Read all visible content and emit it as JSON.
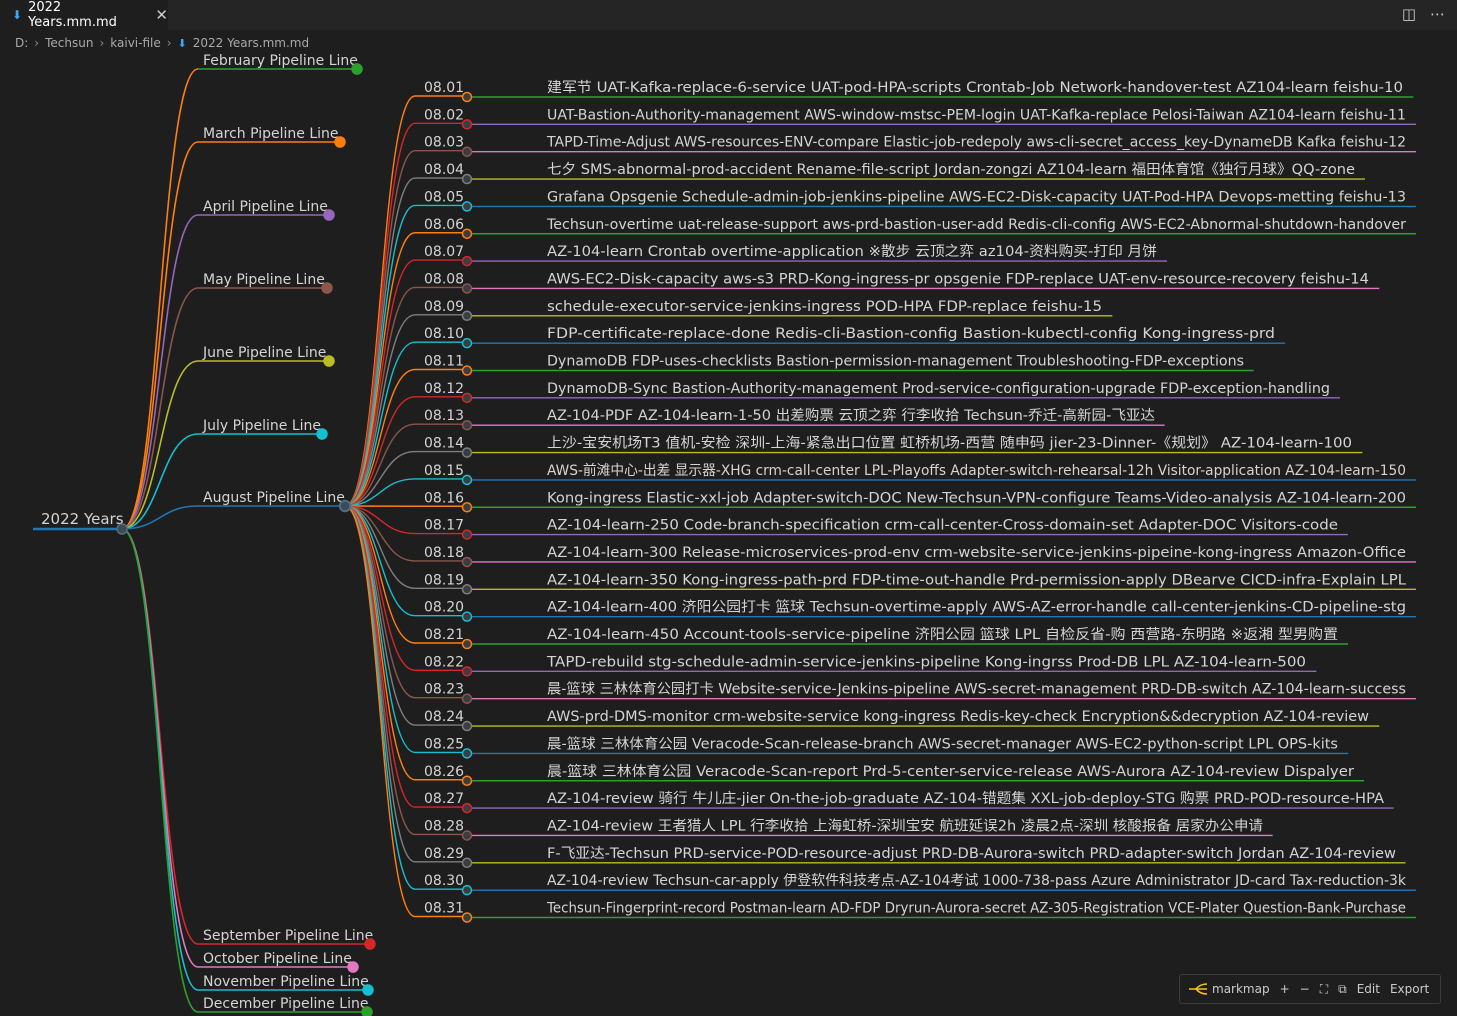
{
  "tab": {
    "title": "2022 Years.mm.md",
    "icon": "markdown-download-icon"
  },
  "breadcrumb": [
    "D:",
    "Techsun",
    "kaivi-file",
    "2022 Years.mm.md"
  ],
  "toolbar": {
    "brand": "markmap",
    "zoom_in": "+",
    "zoom_out": "−",
    "fit": "⛶",
    "toggle": "⧉",
    "edit": "Edit",
    "export": "Export"
  },
  "colors": {
    "root": "#1f77b4",
    "branch": [
      "#ff7f0e",
      "#ff7f0e",
      "#9467bd",
      "#8c564b",
      "#bcbd22",
      "#17becf",
      "#1f77b4",
      "#d62728",
      "#e377c2",
      "#17becf",
      "#2ca02c"
    ],
    "day": [
      "#ff7f0e",
      "#d62728",
      "#8c564b",
      "#7f7f7f",
      "#17becf",
      "#ff7f0e",
      "#d62728",
      "#8c564b",
      "#7f7f7f",
      "#17becf",
      "#ff7f0e",
      "#d62728",
      "#8c564b",
      "#7f7f7f",
      "#17becf",
      "#ff7f0e",
      "#d62728",
      "#8c564b",
      "#7f7f7f",
      "#17becf",
      "#ff7f0e",
      "#d62728",
      "#8c564b",
      "#7f7f7f",
      "#17becf",
      "#ff7f0e",
      "#d62728",
      "#8c564b",
      "#7f7f7f",
      "#17becf",
      "#ff7f0e"
    ],
    "line": [
      "#2ca02c",
      "#9467bd",
      "#e377c2",
      "#bcbd22",
      "#1f77b4",
      "#2ca02c",
      "#9467bd",
      "#e377c2",
      "#bcbd22",
      "#1f77b4",
      "#2ca02c",
      "#9467bd",
      "#e377c2",
      "#bcbd22",
      "#1f77b4",
      "#2ca02c",
      "#9467bd",
      "#e377c2",
      "#bcbd22",
      "#1f77b4",
      "#2ca02c",
      "#9467bd",
      "#e377c2",
      "#bcbd22",
      "#1f77b4",
      "#2ca02c",
      "#9467bd",
      "#e377c2",
      "#bcbd22",
      "#1f77b4",
      "#2ca02c"
    ]
  },
  "mindmap": {
    "root": "2022 Years",
    "months_top": [
      {
        "label": "February Pipeline Line",
        "color": "#2ca02c"
      },
      {
        "label": "March Pipeline Line",
        "color": "#ff7f0e"
      },
      {
        "label": "April Pipeline Line",
        "color": "#9467bd"
      },
      {
        "label": "May Pipeline Line",
        "color": "#8c564b"
      },
      {
        "label": "June Pipeline Line",
        "color": "#bcbd22"
      },
      {
        "label": "July Pipeline Line",
        "color": "#17becf"
      },
      {
        "label": "August Pipeline Line",
        "color": "#1f77b4"
      }
    ],
    "months_bottom": [
      {
        "label": "September Pipeline Line",
        "color": "#d62728"
      },
      {
        "label": "October Pipeline Line",
        "color": "#e377c2"
      },
      {
        "label": "November Pipeline Line",
        "color": "#17becf"
      },
      {
        "label": "December Pipeline Line",
        "color": "#2ca02c"
      }
    ],
    "days": [
      {
        "date": "08.01",
        "text": "建军节 UAT-Kafka-replace-6-service UAT-pod-HPA-scripts Crontab-Job Network-handover-test AZ104-learn feishu-10"
      },
      {
        "date": "08.02",
        "text": "UAT-Bastion-Authority-management AWS-window-mstsc-PEM-login UAT-Kafka-replace Pelosi-Taiwan AZ104-learn feishu-11"
      },
      {
        "date": "08.03",
        "text": "TAPD-Time-Adjust AWS-resources-ENV-compare Elastic-job-redepoly aws-cli-secret_access_key-DynameDB Kafka feishu-12"
      },
      {
        "date": "08.04",
        "text": "七夕 SMS-abnormal-prod-accident Rename-file-script Jordan-zongzi AZ104-learn 福田体育馆《独行月球》QQ-zone"
      },
      {
        "date": "08.05",
        "text": "Grafana Opsgenie Schedule-admin-job-jenkins-pipeline AWS-EC2-Disk-capacity UAT-Pod-HPA Devops-metting feishu-13"
      },
      {
        "date": "08.06",
        "text": "Techsun-overtime uat-release-support aws-prd-bastion-user-add Redis-cli-config AWS-EC2-Abnormal-shutdown-handover"
      },
      {
        "date": "08.07",
        "text": "AZ-104-learn Crontab overtime-application ※散步 云顶之弈 az104-资料购买-打印 月饼"
      },
      {
        "date": "08.08",
        "text": "AWS-EC2-Disk-capacity aws-s3 PRD-Kong-ingress-pr opsgenie FDP-replace UAT-env-resource-recovery feishu-14"
      },
      {
        "date": "08.09",
        "text": "schedule-executor-service-jenkins-ingress POD-HPA FDP-replace feishu-15"
      },
      {
        "date": "08.10",
        "text": "FDP-certificate-replace-done Redis-cli-Bastion-config Bastion-kubectl-config Kong-ingress-prd"
      },
      {
        "date": "08.11",
        "text": "DynamoDB FDP-uses-checklists Bastion-permission-management Troubleshooting-FDP-exceptions"
      },
      {
        "date": "08.12",
        "text": "DynamoDB-Sync Bastion-Authority-management Prod-service-configuration-upgrade FDP-exception-handling"
      },
      {
        "date": "08.13",
        "text": "AZ-104-PDF AZ-104-learn-1-50 出差购票 云顶之弈 行李收拾 Techsun-乔迁-高新园-飞亚达"
      },
      {
        "date": "08.14",
        "text": "上沙-宝安机场T3 值机-安检 深圳-上海-紧急出口位置 虹桥机场-西营 随申码 jier-23-Dinner-《规划》 AZ-104-learn-100"
      },
      {
        "date": "08.15",
        "text": "AWS-前滩中心-出差 显示器-XHG crm-call-center LPL-Playoffs Adapter-switch-rehearsal-12h Visitor-application AZ-104-learn-150"
      },
      {
        "date": "08.16",
        "text": "Kong-ingress Elastic-xxl-job Adapter-switch-DOC New-Techsun-VPN-configure Teams-Video-analysis AZ-104-learn-200"
      },
      {
        "date": "08.17",
        "text": "AZ-104-learn-250 Code-branch-specification crm-call-center-Cross-domain-set Adapter-DOC Visitors-code"
      },
      {
        "date": "08.18",
        "text": "AZ-104-learn-300 Release-microservices-prod-env crm-website-service-jenkins-pipeine-kong-ingress Amazon-Office"
      },
      {
        "date": "08.19",
        "text": "AZ-104-learn-350 Kong-ingress-path-prd FDP-time-out-handle Prd-permission-apply DBearve CICD-infra-Explain LPL"
      },
      {
        "date": "08.20",
        "text": "AZ-104-learn-400 济阳公园打卡 篮球 Techsun-overtime-apply AWS-AZ-error-handle call-center-jenkins-CD-pipeline-stg"
      },
      {
        "date": "08.21",
        "text": "AZ-104-learn-450 Account-tools-service-pipeline 济阳公园 篮球 LPL 自检反省-购 西营路-东明路 ※返湘 型男购置"
      },
      {
        "date": "08.22",
        "text": "TAPD-rebuild stg-schedule-admin-service-jenkins-pipeline Kong-ingrss Prod-DB LPL AZ-104-learn-500"
      },
      {
        "date": "08.23",
        "text": "晨-篮球 三林体育公园打卡 Website-service-Jenkins-pipeline AWS-secret-management PRD-DB-switch AZ-104-learn-success"
      },
      {
        "date": "08.24",
        "text": "AWS-prd-DMS-monitor crm-website-service kong-ingress Redis-key-check Encryption&&decryption AZ-104-review"
      },
      {
        "date": "08.25",
        "text": "晨-篮球 三林体育公园 Veracode-Scan-release-branch AWS-secret-manager AWS-EC2-python-script LPL OPS-kits"
      },
      {
        "date": "08.26",
        "text": "晨-篮球 三林体育公园 Veracode-Scan-report Prd-5-center-service-release AWS-Aurora AZ-104-review Dispalyer"
      },
      {
        "date": "08.27",
        "text": "AZ-104-review 骑行 牛儿庄-jier On-the-job-graduate AZ-104-错题集 XXL-job-deploy-STG 购票 PRD-POD-resource-HPA"
      },
      {
        "date": "08.28",
        "text": "AZ-104-review 王者猎人 LPL 行李收拾 上海虹桥-深圳宝安 航班延误2h 凌晨2点-深圳 核酸报备 居家办公申请"
      },
      {
        "date": "08.29",
        "text": "F-飞亚达-Techsun PRD-service-POD-resource-adjust PRD-DB-Aurora-switch PRD-adapter-switch Jordan AZ-104-review"
      },
      {
        "date": "08.30",
        "text": "AZ-104-review Techsun-car-apply 伊登软件科技考点-AZ-104考试 1000-738-pass Azure Administrator JD-card Tax-reduction-3k"
      },
      {
        "date": "08.31",
        "text": "Techsun-Fingerprint-record Postman-learn AD-FDP Dryrun-Aurora-secret AZ-305-Registration VCE-Plater Question-Bank-Purchase"
      }
    ]
  }
}
